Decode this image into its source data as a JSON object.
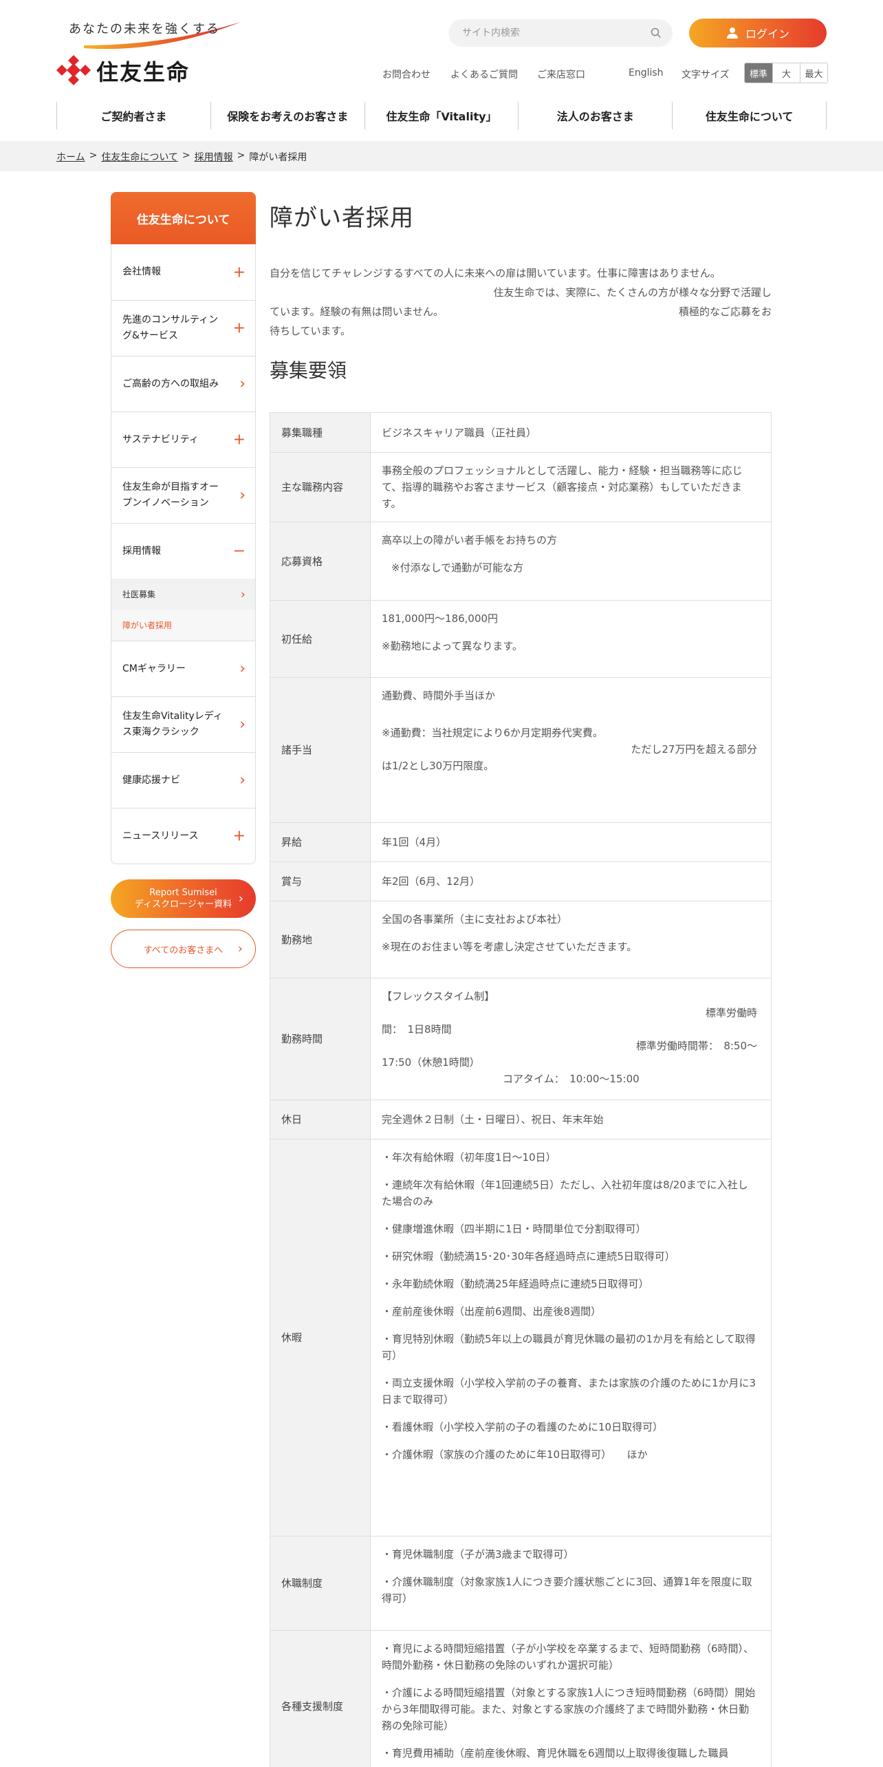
{
  "header": {
    "tagline": "あなたの未来を強くする",
    "brand": "住友生命",
    "search_placeholder": "サイト内検索",
    "login": "ログイン",
    "util": {
      "contact": "お問合わせ",
      "faq": "よくあるご質問",
      "visit": "ご来店窓口",
      "english": "English",
      "font_size_label": "文字サイズ",
      "sizes": [
        "標準",
        "大",
        "最大"
      ]
    },
    "gnav": [
      "ご契約者さま",
      "保険をお考えのお客さま",
      "住友生命「Vitality」",
      "法人のお客さま",
      "住友生命について"
    ]
  },
  "breadcrumb": {
    "home": "ホーム",
    "about": "住友生命について",
    "recruit": "採用情報",
    "current": "障がい者採用",
    "sep": ">"
  },
  "sidebar": {
    "title": "住友生命について",
    "items": [
      {
        "label": "会社情報",
        "mark": "+"
      },
      {
        "label": "先進のコンサルティング&サービス",
        "mark": "+"
      },
      {
        "label": "ご高齢の方への取組み",
        "mark": "›"
      },
      {
        "label": "サステナビリティ",
        "mark": "+"
      },
      {
        "label": "住友生命が目指すオープンイノベーション",
        "mark": "›"
      },
      {
        "label": "採用情報",
        "mark": "−"
      }
    ],
    "sub": [
      {
        "label": "社医募集",
        "mark": "›"
      },
      {
        "label": "障がい者採用"
      }
    ],
    "items2": [
      {
        "label": "CMギャラリー",
        "mark": "›"
      },
      {
        "label": "住友生命Vitalityレディス東海クラシック",
        "mark": "›"
      },
      {
        "label": "健康応援ナビ",
        "mark": "›"
      },
      {
        "label": "ニュースリリース",
        "mark": "+"
      }
    ],
    "report_line1": "Report Sumisei",
    "report_line2": "ディスクロージャー資料",
    "all_customers": "すべてのお客さまへ",
    "arrow": "›"
  },
  "main": {
    "title": "障がい者採用",
    "intro": {
      "line1": "自分を信じてチャレンジするすべての人に未来への扉は開いています。仕事に障害はありません。",
      "line2": "住友生命では、実際に、たくさんの方が様々な分野で活躍し",
      "line3": "ています。経験の有無は問いません。",
      "line3b": "積極的なご応募をお",
      "line4": "待ちしています。"
    },
    "section_title": "募集要領",
    "rows": {
      "job_type": {
        "label": "募集職種",
        "value": "ビジネスキャリア職員（正社員）"
      },
      "duties": {
        "label": "主な職務内容",
        "value": "事務全般のプロフェッショナルとして活躍し、能力・経験・担当職務等に応じて、指導的職務やお客さまサービス（顧客接点・対応業務）もしていただきます。"
      },
      "qualification": {
        "label": "応募資格",
        "v1": "高卒以上の障がい者手帳をお持ちの方",
        "v2": "※付添なしで通勤が可能な方"
      },
      "salary": {
        "label": "初任給",
        "v1": "181,000円〜186,000円",
        "v2": "※勤務地によって異なります。"
      },
      "allowance": {
        "label": "諸手当",
        "v1": "通勤費、時間外手当ほか",
        "v2": "※通勤費：当社規定により6か月定期券代実費。",
        "v3": "ただし27万円を超える部分",
        "v4": "は1/2とし30万円限度。"
      },
      "raise": {
        "label": "昇給",
        "value": "年1回（4月）"
      },
      "bonus": {
        "label": "賞与",
        "value": "年2回（6月、12月）"
      },
      "location": {
        "label": "勤務地",
        "v1": "全国の各事業所（主に支社および本社）",
        "v2": "※現在のお住まい等を考慮し決定させていただきます。"
      },
      "hours": {
        "label": "勤務時間",
        "v1": "【フレックスタイム制】",
        "v2": "標準労働時",
        "v3": "間：　1日8時間",
        "v4": "標準労働時間帯：　8:50〜",
        "v5": "17:50（休憩1時間）",
        "v6": "コアタイム：　10:00〜15:00"
      },
      "holiday": {
        "label": "休日",
        "value": "完全週休２日制（土・日曜日）、祝日、年末年始"
      },
      "leave": {
        "label": "休暇",
        "items": [
          "・年次有給休暇（初年度1日〜10日）",
          "・連続年次有給休暇（年1回連続5日）ただし、入社初年度は8/20までに入社した場合のみ",
          "・健康増進休暇（四半期に1日・時間単位で分割取得可）",
          "・研究休暇（勤続満15･20･30年各経過時点に連続5日取得可）",
          "・永年勤続休暇（勤続満25年経過時点に連続5日取得可）",
          "・産前産後休暇（出産前6週間、出産後8週間）",
          "・育児特別休暇（勤続5年以上の職員が育児休職の最初の1か月を有給として取得可）",
          "・両立支援休暇（小学校入学前の子の養育、または家族の介護のために1か月に3日まで取得可）",
          "・看護休暇（小学校入学前の子の看護のために10日取得可）",
          "・介護休暇（家族の介護のために年10日取得可）　　ほか"
        ]
      },
      "leave_system": {
        "label": "休職制度",
        "items": [
          "・育児休職制度（子が満3歳まで取得可）",
          "・介護休職制度（対象家族1人につき要介護状態ごとに3回、通算1年を限度に取得可）"
        ]
      },
      "support": {
        "label": "各種支援制度",
        "items": [
          "・育児による時間短縮措置（子が小学校を卒業するまで、短時間勤務（6時間）、時間外勤務・休日勤務の免除のいずれか選択可能）",
          "・介護による時間短縮措置（対象とする家族1人につき短時間勤務（6時間）開始から3年間取得可能。また、対象とする家族の介護終了まで時間外勤務・休日勤務の免除可能）",
          "・育児費用補助（産前産後休暇、育児休職を6週間以上取得後復職した職員"
        ]
      }
    }
  },
  "colors": {
    "accent": "#e8572a",
    "gradient_start": "#f5a623",
    "gradient_end": "#e63b2c"
  }
}
